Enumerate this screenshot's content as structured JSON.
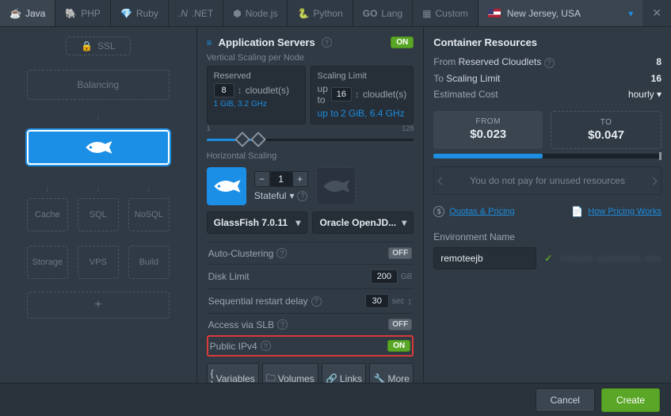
{
  "langs": [
    "Java",
    "PHP",
    "Ruby",
    ".NET",
    "Node.js",
    "Python",
    "Lang",
    "Custom"
  ],
  "lang_prefix_go": "GO",
  "region": "New Jersey, USA",
  "ssl": "SSL",
  "topology": {
    "balancing": "Balancing",
    "cache": "Cache",
    "sql": "SQL",
    "nosql": "NoSQL",
    "storage": "Storage",
    "vps": "VPS",
    "build": "Build"
  },
  "appsrv": {
    "title": "Application Servers",
    "vscale": "Vertical Scaling per Node",
    "reserved": "Reserved",
    "scaling_limit_lbl": "Scaling Limit",
    "reserved_val": "8",
    "limit_val": "16",
    "cloudlets": "cloudlet(s)",
    "upto": "up to",
    "reserved_spec": "1 GiB, 3.2 GHz",
    "limit_spec": "2 GiB, 6.4 GHz",
    "slider_min": "1",
    "slider_max": "128",
    "hscale": "Horizontal Scaling",
    "count": "1",
    "stateful": "Stateful",
    "server": "GlassFish 7.0.11",
    "jdk": "Oracle OpenJD...",
    "auto_cluster": "Auto-Clustering",
    "disk_limit": "Disk Limit",
    "disk_val": "200",
    "disk_unit": "GB",
    "restart": "Sequential restart delay",
    "restart_val": "30",
    "restart_unit": "sec",
    "slb": "Access via SLB",
    "ipv4": "Public IPv4",
    "on": "ON",
    "off": "OFF",
    "variables": "Variables",
    "volumes": "Volumes",
    "links_btn": "Links",
    "more": "More"
  },
  "res": {
    "title": "Container Resources",
    "from_lbl": "From",
    "reserved_cloudlets": "Reserved Cloudlets",
    "from_val": "8",
    "to_lbl": "To",
    "scaling_limit": "Scaling Limit",
    "to_val": "16",
    "est": "Estimated Cost",
    "period": "hourly",
    "cost_from_lbl": "FROM",
    "cost_from": "$0.023",
    "cost_to_lbl": "TO",
    "cost_to": "$0.047",
    "note": "You do not pay for unused resources",
    "quotas": "Quotas & Pricing",
    "howpricing": "How Pricing Works",
    "env_lbl": "Environment Name",
    "env_val": "remoteejb"
  },
  "footer": {
    "cancel": "Cancel",
    "create": "Create"
  }
}
